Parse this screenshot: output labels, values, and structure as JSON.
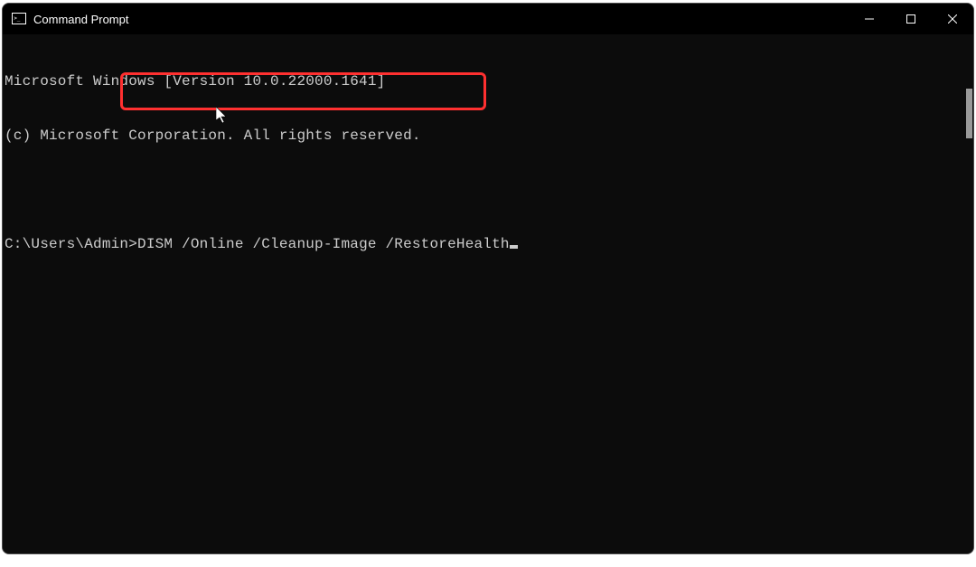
{
  "window": {
    "title": "Command Prompt"
  },
  "terminal": {
    "line1": "Microsoft Windows [Version 10.0.22000.1641]",
    "line2": "(c) Microsoft Corporation. All rights reserved.",
    "prompt": "C:\\Users\\Admin>",
    "command": "DISM /Online /Cleanup-Image /RestoreHealth"
  },
  "icons": {
    "minimize": "minimize-icon",
    "maximize": "maximize-icon",
    "close": "close-icon",
    "app": "console-icon"
  }
}
